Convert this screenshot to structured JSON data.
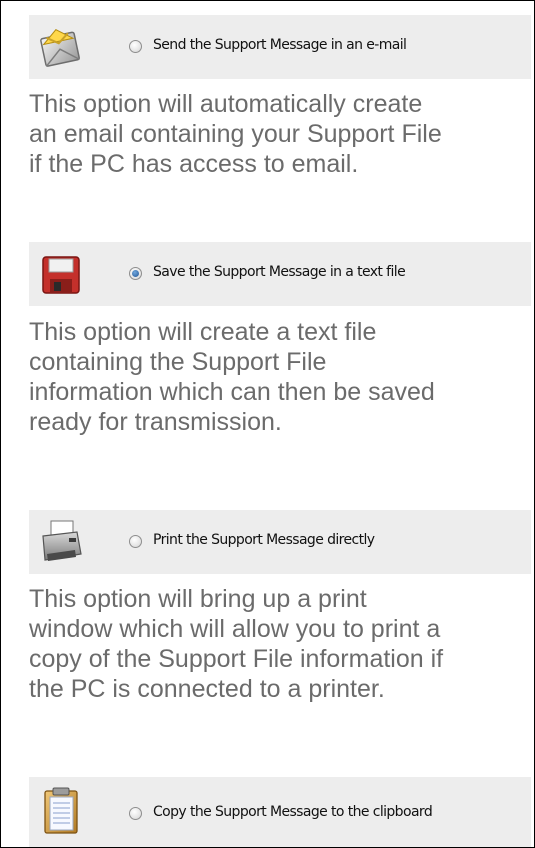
{
  "options": [
    {
      "icon": "envelope-icon",
      "label": "Send the Support Message in an e-mail",
      "selected": false,
      "description_lines": [
        "This option will automatically create",
        "an email containing your Support File",
        "if the PC has access to email."
      ]
    },
    {
      "icon": "floppy-disk-icon",
      "label": "Save the Support Message in a text file",
      "selected": true,
      "description_lines": [
        "This option will create a text file",
        "containing the Support File",
        "information which can then be saved",
        "ready for transmission."
      ]
    },
    {
      "icon": "printer-icon",
      "label": "Print the Support Message directly",
      "selected": false,
      "description_lines": [
        "This option will bring up a print",
        "window which will allow you to print a",
        "copy of the Support File information if",
        "the PC is connected to a printer."
      ]
    },
    {
      "icon": "clipboard-icon",
      "label": "Copy the Support Message to the clipboard",
      "selected": false
    }
  ],
  "colors": {
    "bar_background": "#ededed",
    "description_text": "#6b6b6b",
    "radio_selected": "#2b5f9e"
  }
}
